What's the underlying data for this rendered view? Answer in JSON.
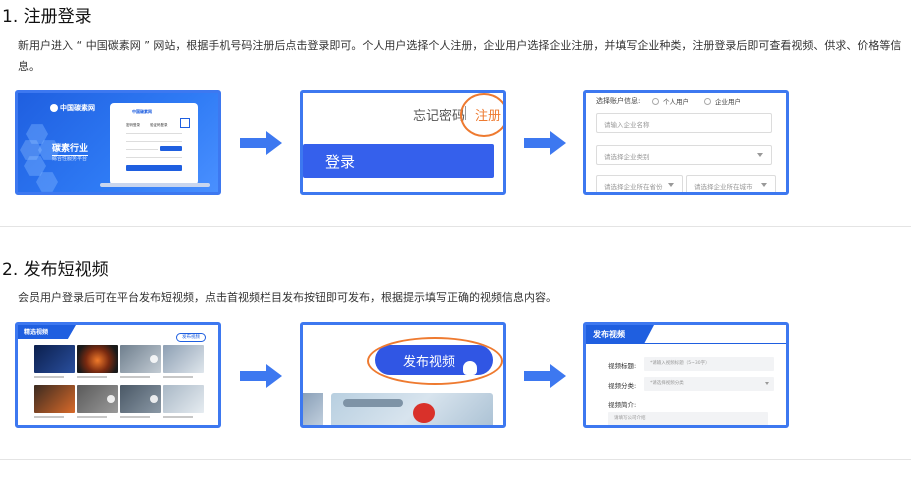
{
  "section1": {
    "title": "1. 注册登录",
    "description": "新用户进入 “ 中国碳素网 ” 网站，根据手机号码注册后点击登录即可。个人用户选择个人注册，企业用户选择企业注册，并填写企业种类，注册登录后即可查看视频、供求、价格等信息。",
    "screen1": {
      "logo_text": "中国碳素网",
      "headline": "碳素行业",
      "subline": "综合性服务平台",
      "form_logo": "中国碳素网",
      "tab_left": "密码登录",
      "tab_right": "验证码登录",
      "submit": "登录"
    },
    "screen2": {
      "forgot_label": "忘记密码",
      "register_label": "注册",
      "login_button": "登录"
    },
    "screen3": {
      "account_type_label": "选择账户信息:",
      "option_personal": "个人用户",
      "option_enterprise": "企业用户",
      "company_name_placeholder": "请输入企业名称",
      "company_type_placeholder": "请选择企业类别",
      "province_placeholder": "请选择企业所在省份",
      "city_placeholder": "请选择企业所在城市"
    }
  },
  "section2": {
    "title": "2. 发布短视频",
    "description": "会员用户登录后可在平台发布短视频，点击首视频栏目发布按钮即可发布，根据提示填写正确的视频信息内容。",
    "screen1": {
      "tab_label": "精选视频",
      "publish_mini": "发布视频"
    },
    "screen2": {
      "publish_button": "发布视频"
    },
    "screen3": {
      "header": "发布视频",
      "title_label": "视频标题:",
      "title_placeholder": "*请输入视频标题（5~30字）",
      "category_label": "视频分类:",
      "category_placeholder": "*请选择视频分类",
      "intro_label": "视频简介:",
      "intro_placeholder": "请填写公司介绍"
    }
  },
  "colors": {
    "frame_border": "#3d78f0",
    "arrow": "#3d78f0",
    "highlight_circle": "#ee7a30",
    "primary_button": "#3560ec"
  }
}
